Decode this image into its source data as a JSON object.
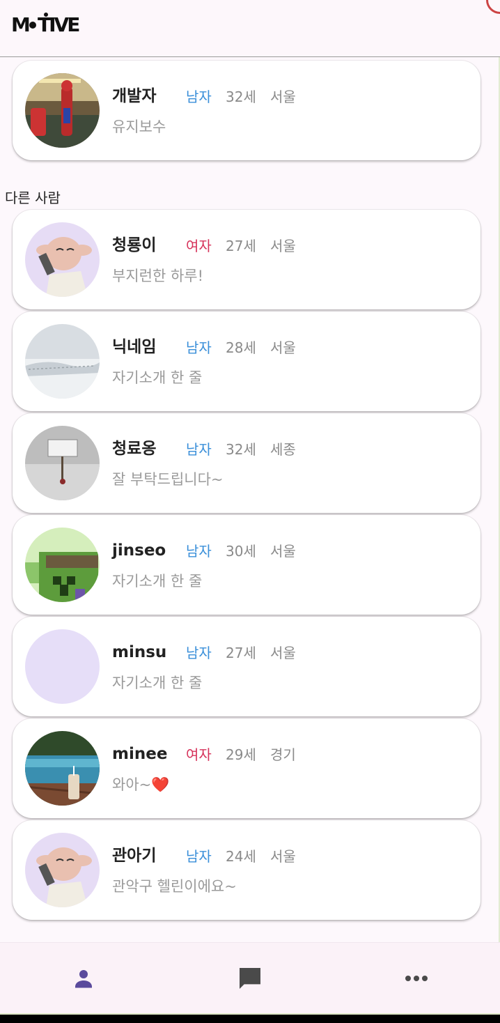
{
  "app": {
    "logo_text": "MOTIVE"
  },
  "my_profile": {
    "name": "개발자",
    "gender": "남자",
    "gender_type": "male",
    "age": "32세",
    "region": "서울",
    "bio": "유지보수",
    "avatar": "spiderman-figure-photo"
  },
  "section_label": "다른 사람",
  "people": [
    {
      "name": "청룡이",
      "gender": "여자",
      "gender_type": "female",
      "age": "27세",
      "region": "서울",
      "bio": "부지런한 하루!",
      "avatar": "dobby-cartoon"
    },
    {
      "name": "닉네임",
      "gender": "남자",
      "gender_type": "male",
      "age": "28세",
      "region": "서울",
      "bio": "자기소개 한 줄",
      "avatar": "snow-field-photo"
    },
    {
      "name": "청료옹",
      "gender": "남자",
      "gender_type": "male",
      "age": "32세",
      "region": "세종",
      "bio": "잘 부탁드립니다~",
      "avatar": "snow-sign-photo"
    },
    {
      "name": "jinseo",
      "gender": "남자",
      "gender_type": "male",
      "age": "30세",
      "region": "서울",
      "bio": "자기소개 한 줄",
      "avatar": "pixel-creeper"
    },
    {
      "name": "minsu",
      "gender": "남자",
      "gender_type": "male",
      "age": "27세",
      "region": "서울",
      "bio": "자기소개 한 줄",
      "avatar": "empty-lavender"
    },
    {
      "name": "minee",
      "gender": "여자",
      "gender_type": "female",
      "age": "29세",
      "region": "경기",
      "bio": "와아~❤️",
      "avatar": "pool-resort-photo"
    },
    {
      "name": "관아기",
      "gender": "남자",
      "gender_type": "male",
      "age": "24세",
      "region": "서울",
      "bio": "관악구 헬린이에요~",
      "avatar": "dobby-cartoon"
    }
  ],
  "nav": [
    {
      "icon": "person-icon",
      "active": true
    },
    {
      "icon": "chat-icon",
      "active": false
    },
    {
      "icon": "more-horizontal-icon",
      "active": false
    }
  ],
  "colors": {
    "male": "#3a8fd9",
    "female": "#d6325a",
    "active_nav": "#5a4a9c",
    "inactive_nav": "#4a4a4a"
  }
}
